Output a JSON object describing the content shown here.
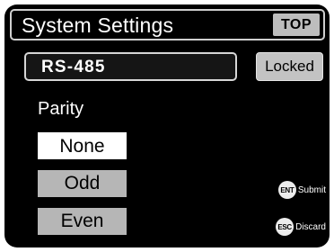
{
  "title": "System Settings",
  "top_button": "TOP",
  "field": {
    "value": "RS-485"
  },
  "locked_label": "Locked",
  "parity": {
    "label": "Parity",
    "options": [
      {
        "label": "None",
        "selected": true
      },
      {
        "label": "Odd",
        "selected": false
      },
      {
        "label": "Even",
        "selected": false
      }
    ]
  },
  "hints": {
    "submit": {
      "key": "ENT",
      "label": "Submit"
    },
    "discard": {
      "key": "ESC",
      "label": "Discard"
    }
  }
}
